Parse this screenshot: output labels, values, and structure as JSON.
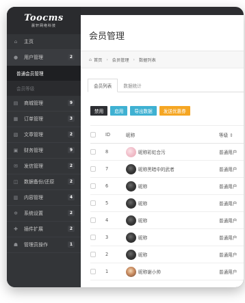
{
  "brand": {
    "logo": "Toocms",
    "subtitle": "晨轩网络科技"
  },
  "sidebar": {
    "items": [
      {
        "icon": "home-icon",
        "glyph": "⌂",
        "label": "主页",
        "badge": ""
      },
      {
        "icon": "user-icon",
        "glyph": "●",
        "label": "用户管理",
        "badge": "2"
      },
      {
        "icon": "shop-icon",
        "glyph": "▤",
        "label": "商城管理",
        "badge": "9"
      },
      {
        "icon": "order-icon",
        "glyph": "▦",
        "label": "订单管理",
        "badge": "3"
      },
      {
        "icon": "article-icon",
        "glyph": "▧",
        "label": "文章管理",
        "badge": "2"
      },
      {
        "icon": "finance-icon",
        "glyph": "▣",
        "label": "财务管理",
        "badge": "9"
      },
      {
        "icon": "message-icon",
        "glyph": "✉",
        "label": "发信管理",
        "badge": "2"
      },
      {
        "icon": "backup-icon",
        "glyph": "◫",
        "label": "数据备份/还原",
        "badge": "2"
      },
      {
        "icon": "content-icon",
        "glyph": "▥",
        "label": "内容管理",
        "badge": "4"
      },
      {
        "icon": "settings-icon",
        "glyph": "✲",
        "label": "系统设置",
        "badge": "2"
      },
      {
        "icon": "plugin-icon",
        "glyph": "✚",
        "label": "插件扩展",
        "badge": "2"
      },
      {
        "icon": "admin-icon",
        "glyph": "☗",
        "label": "管理员操作",
        "badge": "1"
      }
    ],
    "subitems": [
      {
        "label": "普通会员管理",
        "active": true
      },
      {
        "label": "会员等级",
        "active": false
      }
    ]
  },
  "page": {
    "title": "会员管理"
  },
  "breadcrumb": {
    "home": "首页",
    "level1": "会员管理",
    "level2": "数据列表"
  },
  "tabs": {
    "list": "会员列表",
    "stats": "数据统计"
  },
  "toolbar": {
    "disable": "禁用",
    "enable": "启用",
    "export": "导出数据",
    "coupon": "发送优惠券"
  },
  "table": {
    "headers": {
      "id": "ID",
      "nickname": "昵称",
      "level": "等级",
      "sort_glyph": "⇕"
    },
    "rows": [
      {
        "id": "8",
        "nickname": "昵称彩虹合污",
        "level": "普通用户",
        "avatar": "pink"
      },
      {
        "id": "7",
        "nickname": "昵称黑暗中的武者",
        "level": "普通用户",
        "avatar": "dark"
      },
      {
        "id": "6",
        "nickname": "昵称",
        "level": "普通用户",
        "avatar": "dark"
      },
      {
        "id": "5",
        "nickname": "昵称",
        "level": "普通用户",
        "avatar": "dark"
      },
      {
        "id": "4",
        "nickname": "昵称",
        "level": "普通用户",
        "avatar": "dark"
      },
      {
        "id": "3",
        "nickname": "昵称",
        "level": "普通用户",
        "avatar": "dark"
      },
      {
        "id": "2",
        "nickname": "昵称",
        "level": "普通用户",
        "avatar": "dark"
      },
      {
        "id": "1",
        "nickname": "昵称谢小帅",
        "level": "普通用户",
        "avatar": "warm"
      }
    ]
  },
  "colors": {
    "sidebar": "#333538",
    "accent_blue": "#3fb1d2",
    "accent_orange": "#f5a623",
    "dark_button": "#2d2f33"
  }
}
